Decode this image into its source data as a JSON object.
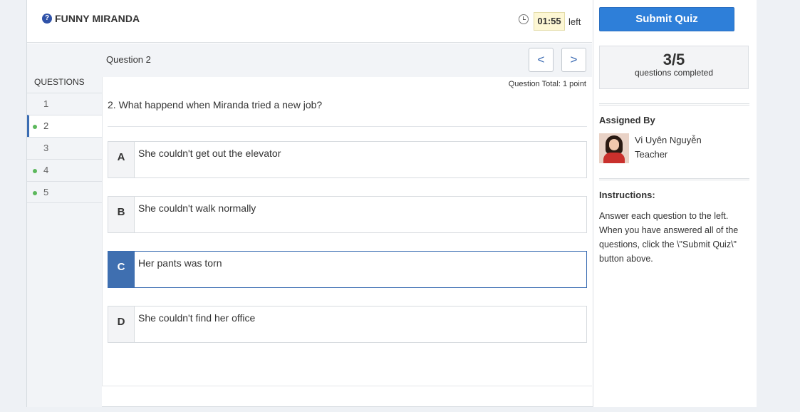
{
  "header": {
    "logo_icon": "question-bubble-icon",
    "title": "FUNNY MIRANDA",
    "timer_icon": "clock-icon",
    "timer_value": "01:55",
    "timer_suffix": "left"
  },
  "questions_nav": {
    "heading": "QUESTIONS",
    "items": [
      {
        "label": "1",
        "answered": false,
        "active": false
      },
      {
        "label": "2",
        "answered": true,
        "active": true
      },
      {
        "label": "3",
        "answered": false,
        "active": false
      },
      {
        "label": "4",
        "answered": true,
        "active": false
      },
      {
        "label": "5",
        "answered": true,
        "active": false
      }
    ]
  },
  "question": {
    "label": "Question 2",
    "prev_label": "<",
    "next_label": ">",
    "total": "Question Total: 1 point",
    "text": "2. What happend when Miranda tried a new job?",
    "options": [
      {
        "letter": "A",
        "text": "She couldn't get out the elevator",
        "selected": false
      },
      {
        "letter": "B",
        "text": "She couldn't walk normally",
        "selected": false
      },
      {
        "letter": "C",
        "text": "Her pants was torn",
        "selected": true
      },
      {
        "letter": "D",
        "text": "She couldn't find her office",
        "selected": false
      }
    ]
  },
  "sidebar": {
    "submit_label": "Submit Quiz",
    "progress_count": "3/5",
    "progress_label": "questions completed",
    "assigned_title": "Assigned By",
    "teacher_name": "Vi Uyên Nguyễn",
    "teacher_role": "Teacher",
    "instructions_title": "Instructions:",
    "instructions_text": "Answer each question to the left. When you have answered all of the questions, click the \\\"Submit Quiz\\\" button above."
  },
  "colors": {
    "accent": "#2e7fd9",
    "selected": "#3f6fb0",
    "answered_dot": "#5cb85c",
    "timer_bg": "#fdf7d4"
  }
}
